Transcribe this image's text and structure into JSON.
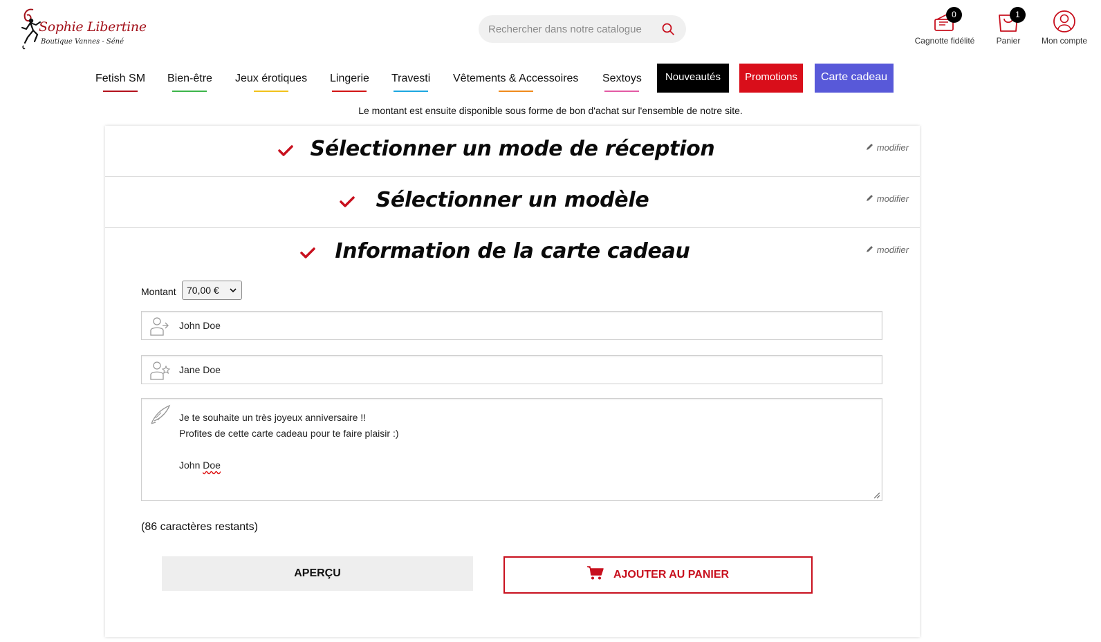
{
  "brand": {
    "name": "Sophie Libertine",
    "tagline": "Boutique Vannes - Séné"
  },
  "search": {
    "placeholder": "Rechercher dans notre catalogue"
  },
  "header_actions": [
    {
      "label": "Cagnotte fidélité",
      "badge": "0",
      "icon": "wallet-icon"
    },
    {
      "label": "Panier",
      "badge": "1",
      "icon": "shopping-bag-icon"
    },
    {
      "label": "Mon compte",
      "icon": "user-icon"
    }
  ],
  "nav": {
    "items": [
      {
        "label": "Fetish SM",
        "color": "#b3111c"
      },
      {
        "label": "Bien-être",
        "color": "#3cb54a"
      },
      {
        "label": "Jeux érotiques",
        "color": "#f2c21b"
      },
      {
        "label": "Lingerie",
        "color": "#d21414"
      },
      {
        "label": "Travesti",
        "color": "#1ca7e0"
      },
      {
        "label": "Vêtements & Accessoires",
        "color": "#f08a1c"
      },
      {
        "label": "Sextoys",
        "color": "#e35aa4"
      }
    ],
    "boxed": [
      {
        "label": "Nouveautés",
        "bg": "#000000"
      },
      {
        "label": "Promotions",
        "bg": "#d90e1a"
      },
      {
        "label": "Carte cadeau",
        "bg": "#5859d9"
      }
    ]
  },
  "intro_text": "Le montant est ensuite disponible sous forme de bon d'achat sur l'ensemble de notre site.",
  "steps": [
    {
      "title": "Sélectionner un mode de réception",
      "modify": "modifier"
    },
    {
      "title": "Sélectionner un modèle",
      "modify": "modifier"
    },
    {
      "title": "Information de la carte cadeau",
      "modify": "modifier"
    }
  ],
  "form": {
    "amount_label": "Montant",
    "amount_value": "70,00 €",
    "from_name": "John Doe",
    "to_name": "Jane Doe",
    "message_lines": [
      "Je te souhaite un très joyeux anniversaire !!",
      "Profites de cette carte cadeau pour te faire plaisir :)",
      "",
      "John"
    ],
    "message_misspelled": "Doe",
    "remaining": "(86 caractères restants)"
  },
  "buttons": {
    "preview": "APERÇU",
    "add_to_cart": "AJOUTER AU PANIER"
  },
  "colors": {
    "accent_red": "#c8101e",
    "check_red": "#c8101e"
  }
}
